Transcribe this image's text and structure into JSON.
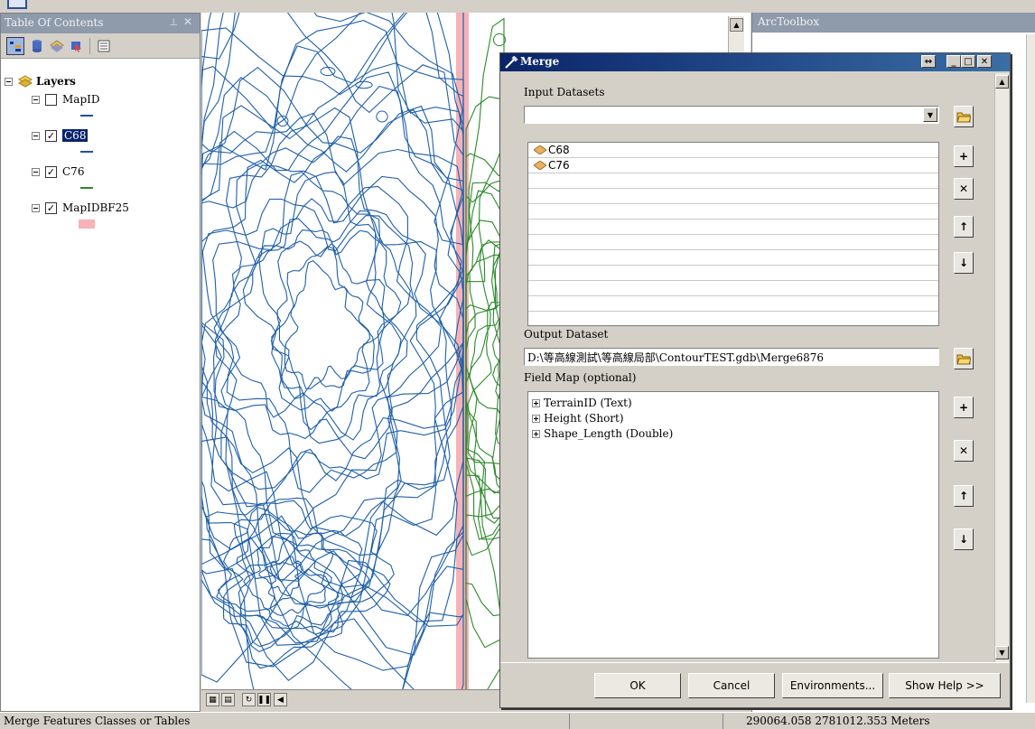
{
  "toc": {
    "title": "Table Of Contents",
    "root_label": "Layers",
    "layers": [
      {
        "name": "MapID",
        "checked": false,
        "legend_color": "#1f4fa0",
        "selected": false
      },
      {
        "name": "C68",
        "checked": true,
        "legend_color": "#1f4fa0",
        "selected": true
      },
      {
        "name": "C76",
        "checked": true,
        "legend_color": "#2a8a2a",
        "selected": false
      },
      {
        "name": "MapIDBF25",
        "checked": true,
        "legend_color": "#f5b3b8",
        "selected": false
      }
    ]
  },
  "arctoolbox": {
    "title": "ArcToolbox"
  },
  "merge": {
    "title": "Merge",
    "input_label": "Input Datasets",
    "input_value": "",
    "input_items": [
      "C68",
      "C76"
    ],
    "output_label": "Output Dataset",
    "output_value": "D:\\等高線測試\\等高線局部\\ContourTEST.gdb\\Merge6876",
    "fieldmap_label": "Field Map (optional)",
    "fields": [
      "TerrainID (Text)",
      "Height (Short)",
      "Shape_Length (Double)"
    ],
    "buttons": {
      "ok": "OK",
      "cancel": "Cancel",
      "env": "Environments...",
      "help": "Show Help >>"
    }
  },
  "status": {
    "message": "Merge Features Classes or Tables",
    "coords": "290064.058  2781012.353 Meters"
  },
  "colors": {
    "contour_blue": "#1f5fa8",
    "contour_green": "#2a8a2a",
    "buffer_pink": "#f5b3b8",
    "title_bar": "#0a246a"
  }
}
